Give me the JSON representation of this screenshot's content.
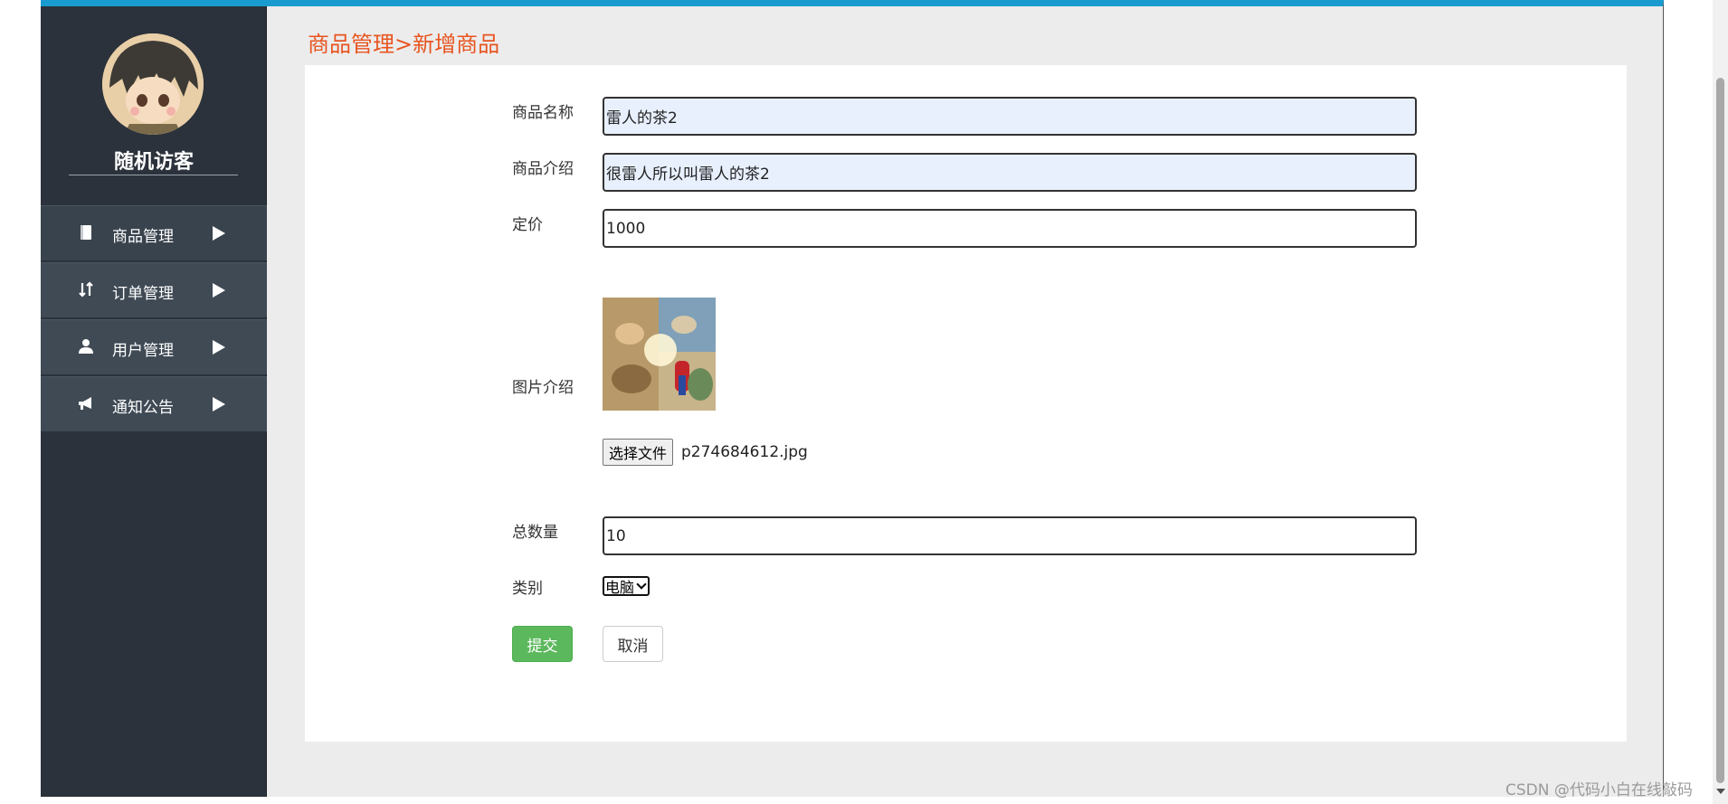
{
  "user": {
    "name": "随机访客"
  },
  "sidebar": {
    "items": [
      {
        "label": "商品管理",
        "icon": "book-icon"
      },
      {
        "label": "订单管理",
        "icon": "sort-arrows-icon"
      },
      {
        "label": "用户管理",
        "icon": "user-icon"
      },
      {
        "label": "通知公告",
        "icon": "bullhorn-icon"
      }
    ]
  },
  "breadcrumb": "商品管理>新增商品",
  "form": {
    "name_label": "商品名称",
    "name_value": "雷人的茶2",
    "intro_label": "商品介绍",
    "intro_value": "很雷人所以叫雷人的茶2",
    "price_label": "定价",
    "price_value": "1000",
    "image_label": "图片介绍",
    "file_button": "选择文件",
    "file_name": "p274684612.jpg",
    "total_label": "总数量",
    "total_value": "10",
    "category_label": "类别",
    "category_value": "电脑",
    "submit_label": "提交",
    "cancel_label": "取消"
  },
  "colors": {
    "accent_top": "#1a9bd0",
    "breadcrumb": "#e8541f",
    "submit": "#5cb85c",
    "sidebar_bg": "#2b323b"
  },
  "watermark": "CSDN @代码小白在线敲码"
}
